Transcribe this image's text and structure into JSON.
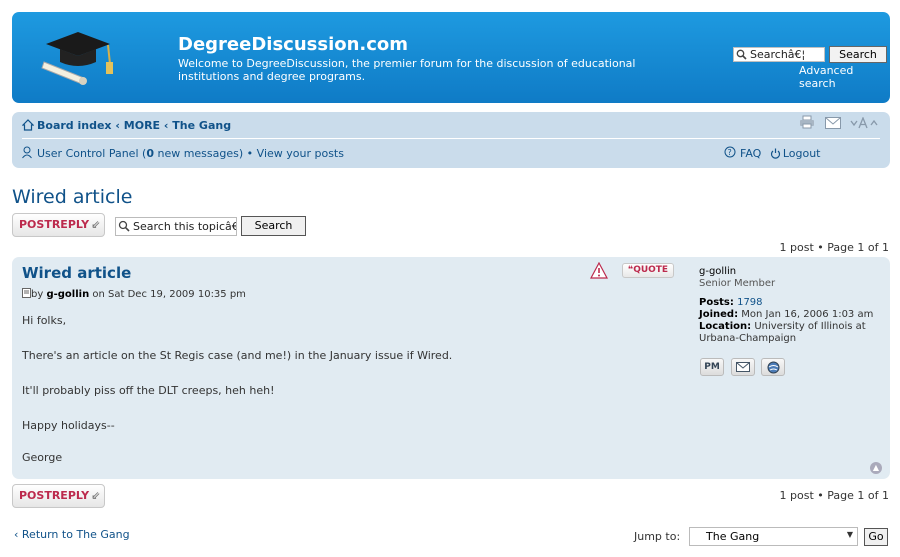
{
  "header": {
    "site_title": "DegreeDiscussion.com",
    "site_description": "Welcome to DegreeDiscussion, the premier forum for the discussion of educational institutions and degree programs.",
    "search_value": "Searchâ€¦",
    "search_button": "Search",
    "advanced_search": "Advanced search"
  },
  "nav": {
    "breadcrumbs": [
      "Board index",
      "MORE",
      "The Gang"
    ],
    "breadcrumb_separator": "‹",
    "ucp_label": "User Control Panel",
    "new_messages_count": "0",
    "new_messages_label": "new messages",
    "view_posts": "View your posts",
    "faq": "FAQ",
    "logout": "Logout"
  },
  "topic": {
    "title": "Wired article",
    "post_reply": "POSTREPLY",
    "search_value": "Search this topicâ€¦",
    "search_button": "Search",
    "pagination_top": "1 post • Page 1 of 1",
    "pagination_bottom": "1 post • Page 1 of 1",
    "page_num": "1",
    "page_total": "1"
  },
  "post": {
    "title": "Wired article",
    "by": "by",
    "author": "g-gollin",
    "date": "on Sat Dec 19, 2009 10:35 pm",
    "quote_label": "QUOTE",
    "body": [
      "Hi folks,",
      "There's an article on the St Regis case (and me!) in the January issue if Wired.",
      "It'll probably piss off the DLT creeps, heh heh!",
      "Happy holidays--",
      "George"
    ],
    "profile": {
      "username": "g-gollin",
      "rank": "Senior Member",
      "posts_label": "Posts:",
      "posts": "1798",
      "joined_label": "Joined:",
      "joined": "Mon Jan 16, 2006 1:03 am",
      "location_label": "Location:",
      "location": "University of Illinois at Urbana-Champaign",
      "pm_label": "PM"
    }
  },
  "footer": {
    "return_link": "Return to The Gang",
    "jump_to_label": "Jump to:",
    "jump_selected": "The Gang",
    "go_button": "Go"
  },
  "colors": {
    "header_blue": "#1e9ae0",
    "nav_bg": "#cadceb",
    "post_bg": "#e1ebf2",
    "link": "#105289",
    "reply_red": "#bc2a4d"
  }
}
